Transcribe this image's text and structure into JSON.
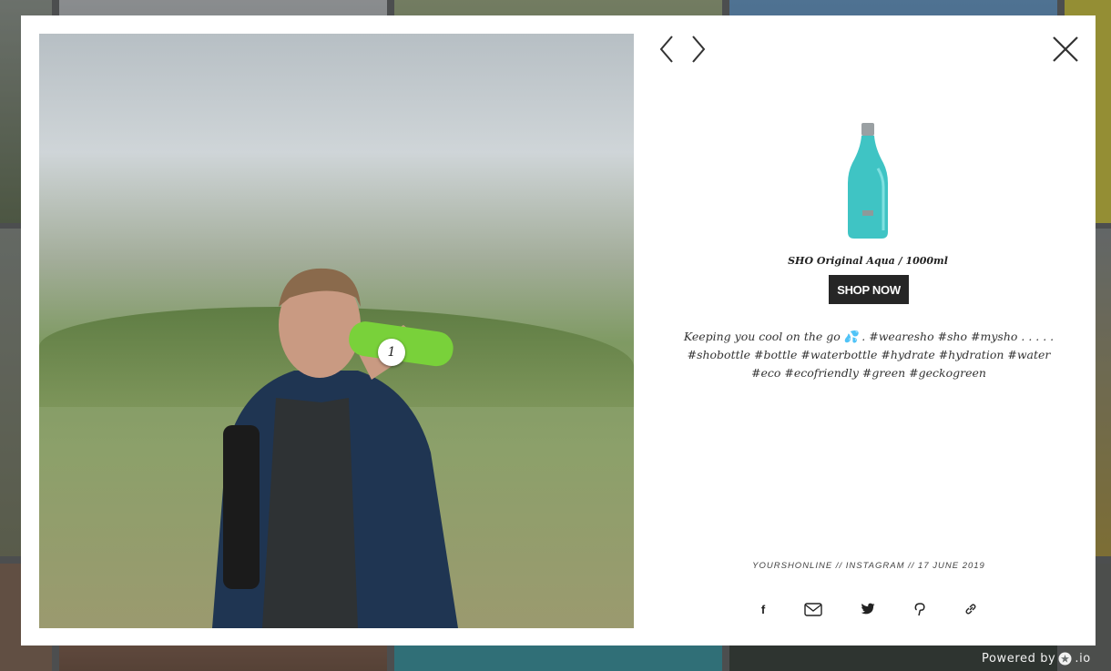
{
  "gallery": {
    "tile_count": 12
  },
  "lightbox": {
    "photo_tag_number": "1",
    "product": {
      "name": "SHO Original Aqua / 1000ml",
      "bottle_color": "#3fc4c4",
      "cta_label": "SHOP NOW"
    },
    "caption": "Keeping you cool on the go 💦 . #wearesho #sho #mysho . . . . . #shobottle #bottle #waterbottle #hydrate #hydration #water #eco #ecofriendly #green #geckogreen",
    "meta": "YOURSHONLINE // INSTAGRAM // 17 JUNE 2019",
    "share": {
      "facebook": "f",
      "icons": [
        "facebook-icon",
        "mail-icon",
        "twitter-icon",
        "pinterest-icon",
        "link-icon"
      ]
    }
  },
  "footer": {
    "powered_prefix": "Powered by",
    "powered_suffix": ".io"
  }
}
